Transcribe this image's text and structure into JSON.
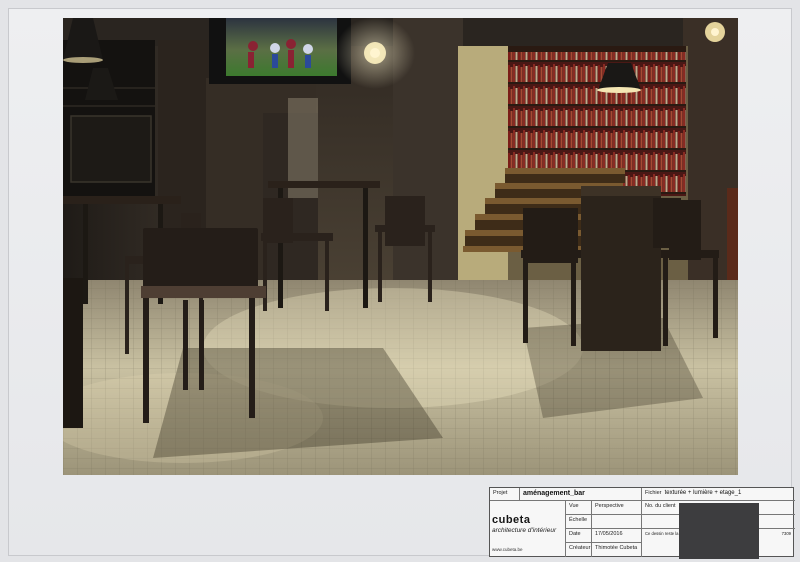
{
  "title_block": {
    "projet_label": "Projet",
    "projet_value": "aménagement_bar",
    "fichier_label": "Fichier",
    "fichier_value": "texturée + lumière + etage_1",
    "vue_label": "Vue",
    "vue_value": "Perspective",
    "client_label": "No. du client",
    "echelle_label": "Échelle",
    "echelle_value": "",
    "date_label": "Date",
    "date_value": "17/05/2016",
    "createur_label": "Créateur",
    "createur_value": "Thimotée Cubeta",
    "note_text": "Ce dessin reste la p... Herne (Bassoisé...",
    "note_code": "7309"
  },
  "company": {
    "logo": "cubeta",
    "tagline": "architecture d'intérieur",
    "website": "www.cubeta.be"
  },
  "colors": {
    "floor_tile": "#b9b08f",
    "wall_warm": "#3a2f26",
    "bookshelf": "#5a1e1a",
    "redaction": "#3d3d3f"
  }
}
